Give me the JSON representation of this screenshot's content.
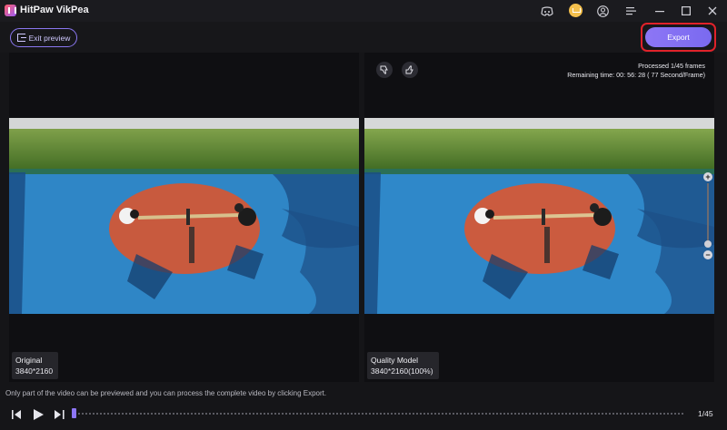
{
  "app": {
    "title": "HitPaw VikPea"
  },
  "toolbar": {
    "exit_label": "Exit preview",
    "export_label": "Export"
  },
  "left_panel": {
    "name": "Original",
    "resolution": "3840*2160"
  },
  "right_panel": {
    "name": "Quality Model",
    "resolution": "3840*2160(100%)",
    "processed": "Processed 1/45 frames",
    "remaining": "Remaining time: 00: 56: 28 ( 77 Second/Frame)"
  },
  "zoom": {
    "plus": "+",
    "minus": "−"
  },
  "notice": "Only part of the video can be previewed and you can process the complete video by clicking Export.",
  "playback": {
    "frame_counter": "1/45"
  },
  "icons": [
    "discord-icon",
    "vip-crown-icon",
    "user-icon",
    "menu-icon",
    "minimize-icon",
    "maximize-icon",
    "close-icon",
    "exit-preview-icon",
    "thumbs-down-icon",
    "thumbs-up-icon",
    "prev-frame-icon",
    "play-icon",
    "next-frame-icon"
  ],
  "colors": {
    "accent": "#8d76f5",
    "highlight_border": "#e0222a",
    "background": "#151518"
  }
}
